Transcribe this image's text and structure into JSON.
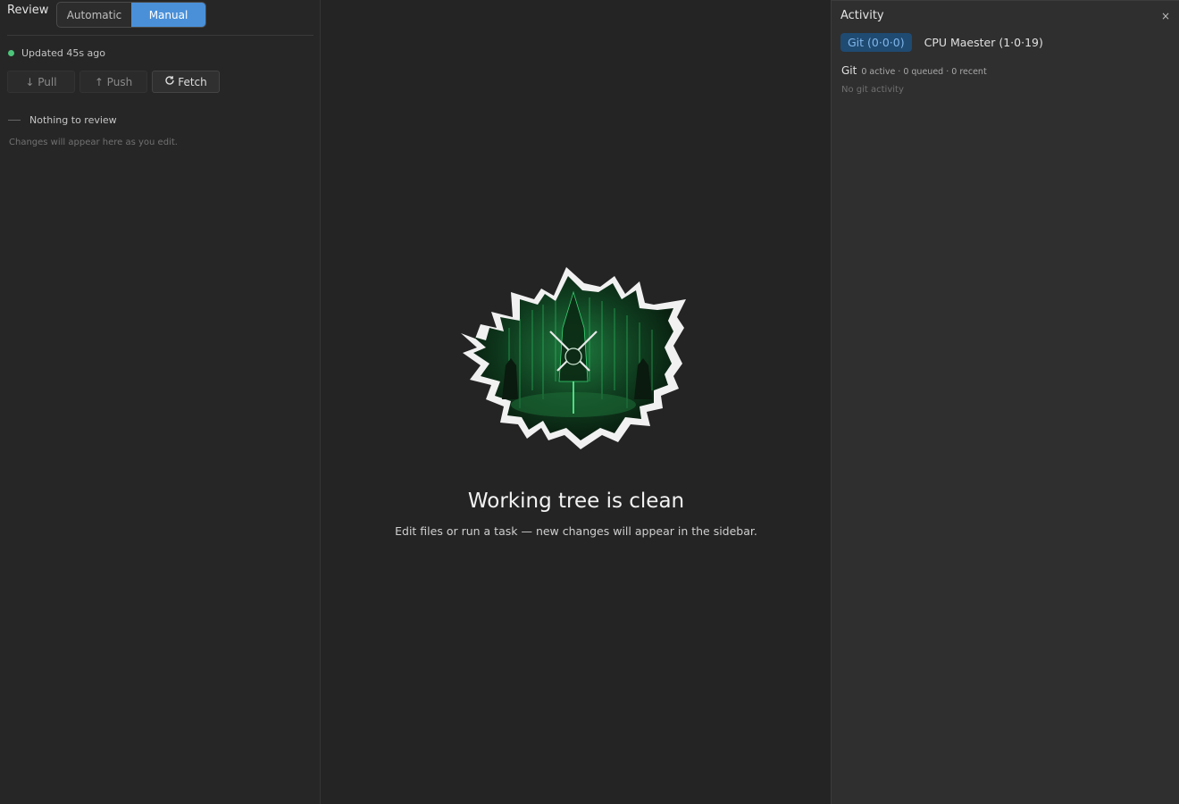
{
  "sidebar": {
    "title": "Review",
    "modes": [
      {
        "label": "Automatic",
        "active": false
      },
      {
        "label": "Manual",
        "active": true
      }
    ],
    "status_text": "Updated 45s ago",
    "status_color": "#4cc57a",
    "actions": [
      {
        "label": "↓ Pull",
        "enabled": false
      },
      {
        "label": "↑ Push",
        "enabled": false
      },
      {
        "label": "Fetch",
        "icon": "refresh-icon",
        "enabled": true
      }
    ],
    "empty_title": "Nothing to review",
    "empty_hint": "Changes will appear here as you edit."
  },
  "main": {
    "illustration": "torn-paper-matrix-image",
    "title": "Working tree is clean",
    "subtitle": "Edit files or run a task — new changes will appear in the sidebar."
  },
  "activity": {
    "title": "Activity",
    "close_label": "×",
    "tabs": [
      {
        "label": "Git (0·0·0)",
        "active": true
      },
      {
        "label": "CPU Maester (1·0·19)",
        "active": false
      }
    ],
    "git_label": "Git",
    "git_stats": "0 active · 0 queued · 0 recent",
    "empty_text": "No git activity"
  },
  "colors": {
    "accent": "#4a90d9",
    "background": "#242424",
    "panel": "#2f2f2f",
    "matrix_green": "#2fd36b"
  }
}
